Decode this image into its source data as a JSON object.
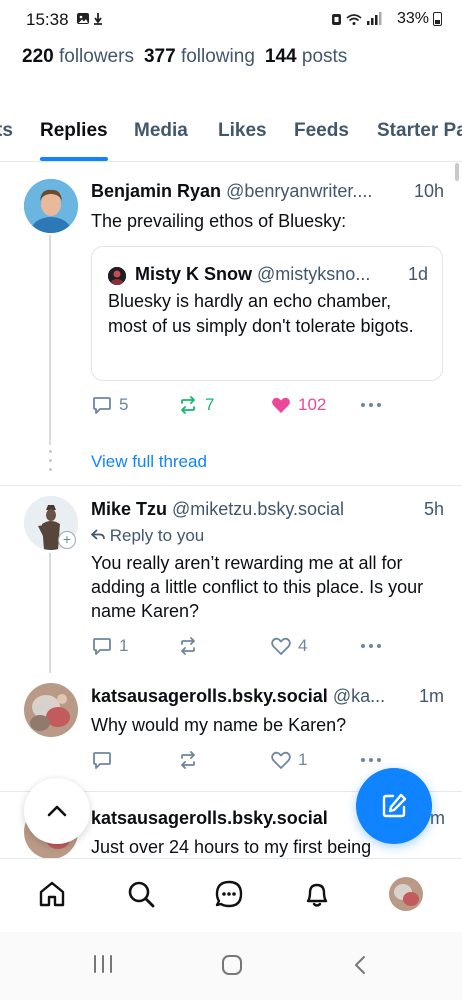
{
  "status_bar": {
    "time": "15:38",
    "battery": "33%"
  },
  "profile": {
    "followers_count": "220",
    "followers_label": "followers",
    "following_count": "377",
    "following_label": "following",
    "posts_count": "144",
    "posts_label": "posts"
  },
  "tabs": [
    {
      "label": "ts"
    },
    {
      "label": "Replies",
      "active": true
    },
    {
      "label": "Media"
    },
    {
      "label": "Likes"
    },
    {
      "label": "Feeds"
    },
    {
      "label": "Starter Pa"
    }
  ],
  "posts": [
    {
      "author": "Benjamin Ryan",
      "handle": "@benryanwriter....",
      "time": "10h",
      "text": "The prevailing ethos of Bluesky:",
      "quote": {
        "author": "Misty K Snow",
        "handle": "@mistyksno...",
        "time": "1d",
        "text": "Bluesky is hardly an echo chamber, most of us simply don't tolerate bigots."
      },
      "replies": "5",
      "reposts": "7",
      "likes": "102",
      "view_full_thread": "View full thread"
    },
    {
      "author": "Mike Tzu",
      "handle": "@miketzu.bsky.social",
      "time": "5h",
      "reply_to": "Reply to you",
      "text": "You really aren’t rewarding me at all for adding a little conflict to this place. Is your name Karen?",
      "replies": "1",
      "reposts": "",
      "likes": "4"
    },
    {
      "author": "katsausagerolls.bsky.social",
      "handle": "@ka...",
      "time": "1m",
      "text": "Why would my name be Karen?",
      "replies": "",
      "reposts": "",
      "likes": "1"
    },
    {
      "author": "katsausagerolls.bsky.social",
      "handle": "",
      "time": "m",
      "text": "Just over 24 hours to my first being"
    }
  ],
  "colors": {
    "accent": "#1083fe",
    "repost_active": "#13b86f",
    "like_active": "#ec4899",
    "muted": "#6f869f"
  },
  "icons": {
    "nav": [
      "home-icon",
      "search-icon",
      "chat-icon",
      "notifications-icon",
      "profile-avatar"
    ],
    "fab": "compose-icon",
    "scroll": "chevron-up-icon"
  }
}
